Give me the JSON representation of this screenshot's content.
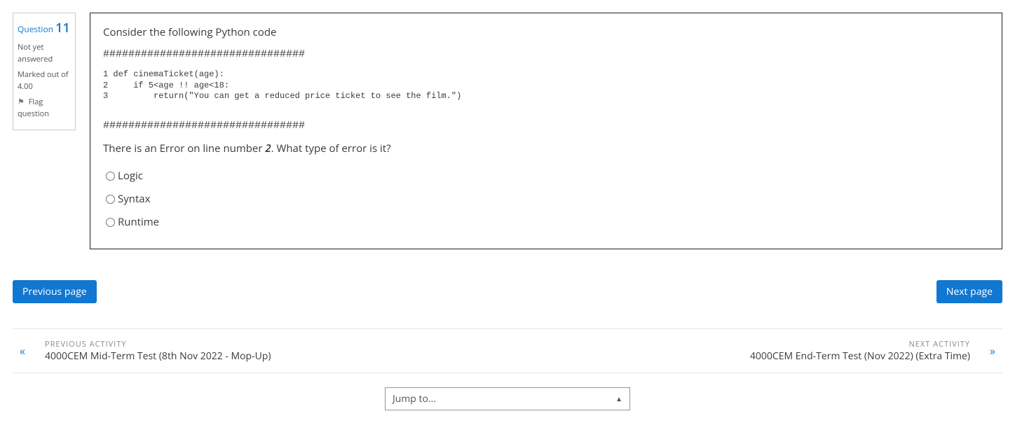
{
  "info": {
    "question_label": "Question",
    "question_number": "11",
    "status_line1": "Not yet",
    "status_line2": "answered",
    "marked_line1": "Marked out of",
    "marked_line2": "4.00",
    "flag_line1": "Flag",
    "flag_line2": "question"
  },
  "content": {
    "intro": "Consider the following Python code",
    "hashes": "################################",
    "code": "1 def cinemaTicket(age):\n2     if 5<age !! age<18:\n3         return(\"You can get a reduced price ticket to see the film.\")",
    "question_pre": "There is an Error on line number ",
    "question_bold": "2",
    "question_post": ". What type of error is it?",
    "options": {
      "opt1": "Logic",
      "opt2": "Syntax",
      "opt3": "Runtime"
    }
  },
  "pager": {
    "prev": "Previous page",
    "next": "Next page"
  },
  "activity": {
    "prev_sub": "PREVIOUS ACTIVITY",
    "prev_title": "4000CEM Mid-Term Test (8th Nov 2022 - Mop-Up)",
    "next_sub": "NEXT ACTIVITY",
    "next_title": "4000CEM End-Term Test (Nov 2022) (Extra Time)"
  },
  "jump": {
    "placeholder": "Jump to..."
  },
  "glyphs": {
    "flag": "⚑",
    "left": "«",
    "right": "»",
    "caret": "▲"
  }
}
